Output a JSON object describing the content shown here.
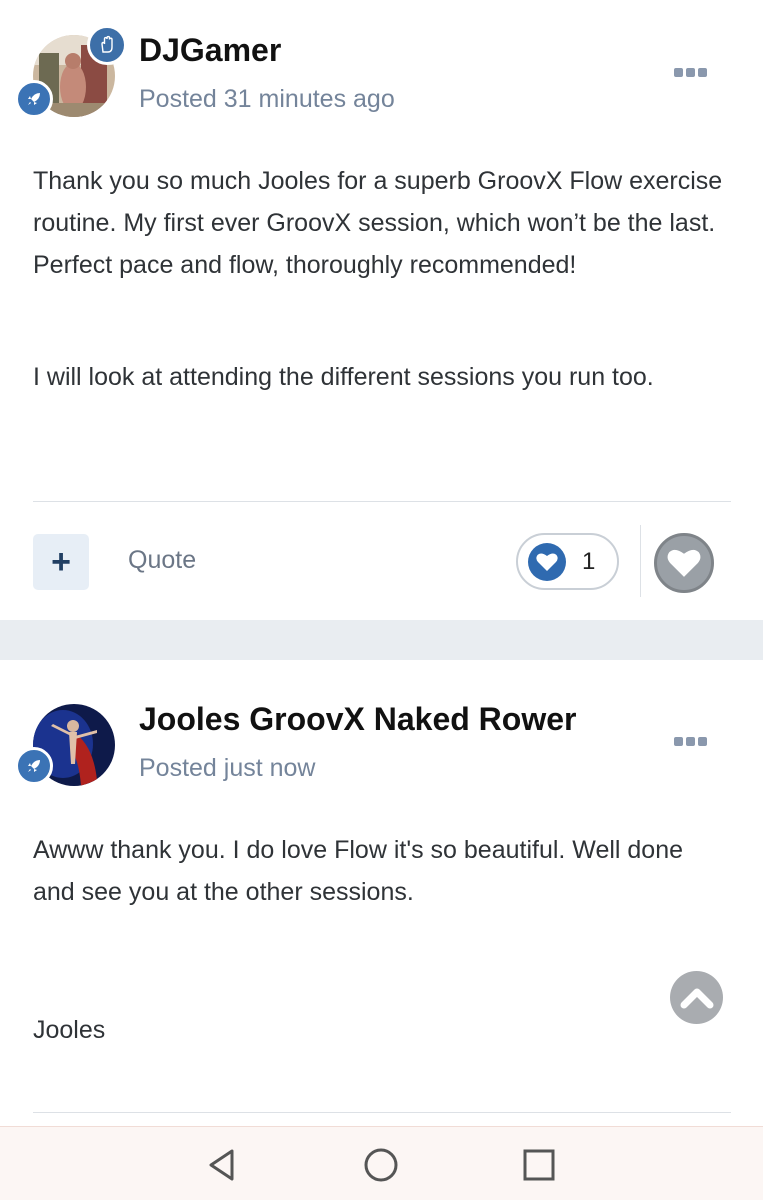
{
  "posts": [
    {
      "author": "DJGamer",
      "posted": "Posted 31 minutes ago",
      "paragraphs": [
        "Thank you so much Jooles for a superb GroovX Flow exercise routine. My first ever GroovX session, which won’t be the last. Perfect pace and flow, thoroughly recommended!",
        "I will look at attending the different sessions you run too."
      ],
      "actions": {
        "plus_label": "+",
        "quote_label": "Quote",
        "reaction_count": "1"
      }
    },
    {
      "author": "Jooles GroovX Naked Rower",
      "posted": "Posted just now",
      "paragraphs": [
        "Awww thank you. I do love Flow it's so beautiful. Well done and see you at the other sessions.",
        "Jooles"
      ]
    }
  ],
  "icons": {
    "rank_badge": "rocket-icon",
    "group_badge": "hand-icon",
    "reaction": "heart-icon",
    "menu": "ellipsis-icon",
    "scroll_top": "chevron-up-icon",
    "nav": [
      "back-triangle-icon",
      "home-circle-icon",
      "recents-square-icon"
    ]
  },
  "colors": {
    "badge_blue": "#3b73b5",
    "reaction_blue": "#2f6ab0",
    "meta_gray": "#74849a"
  }
}
